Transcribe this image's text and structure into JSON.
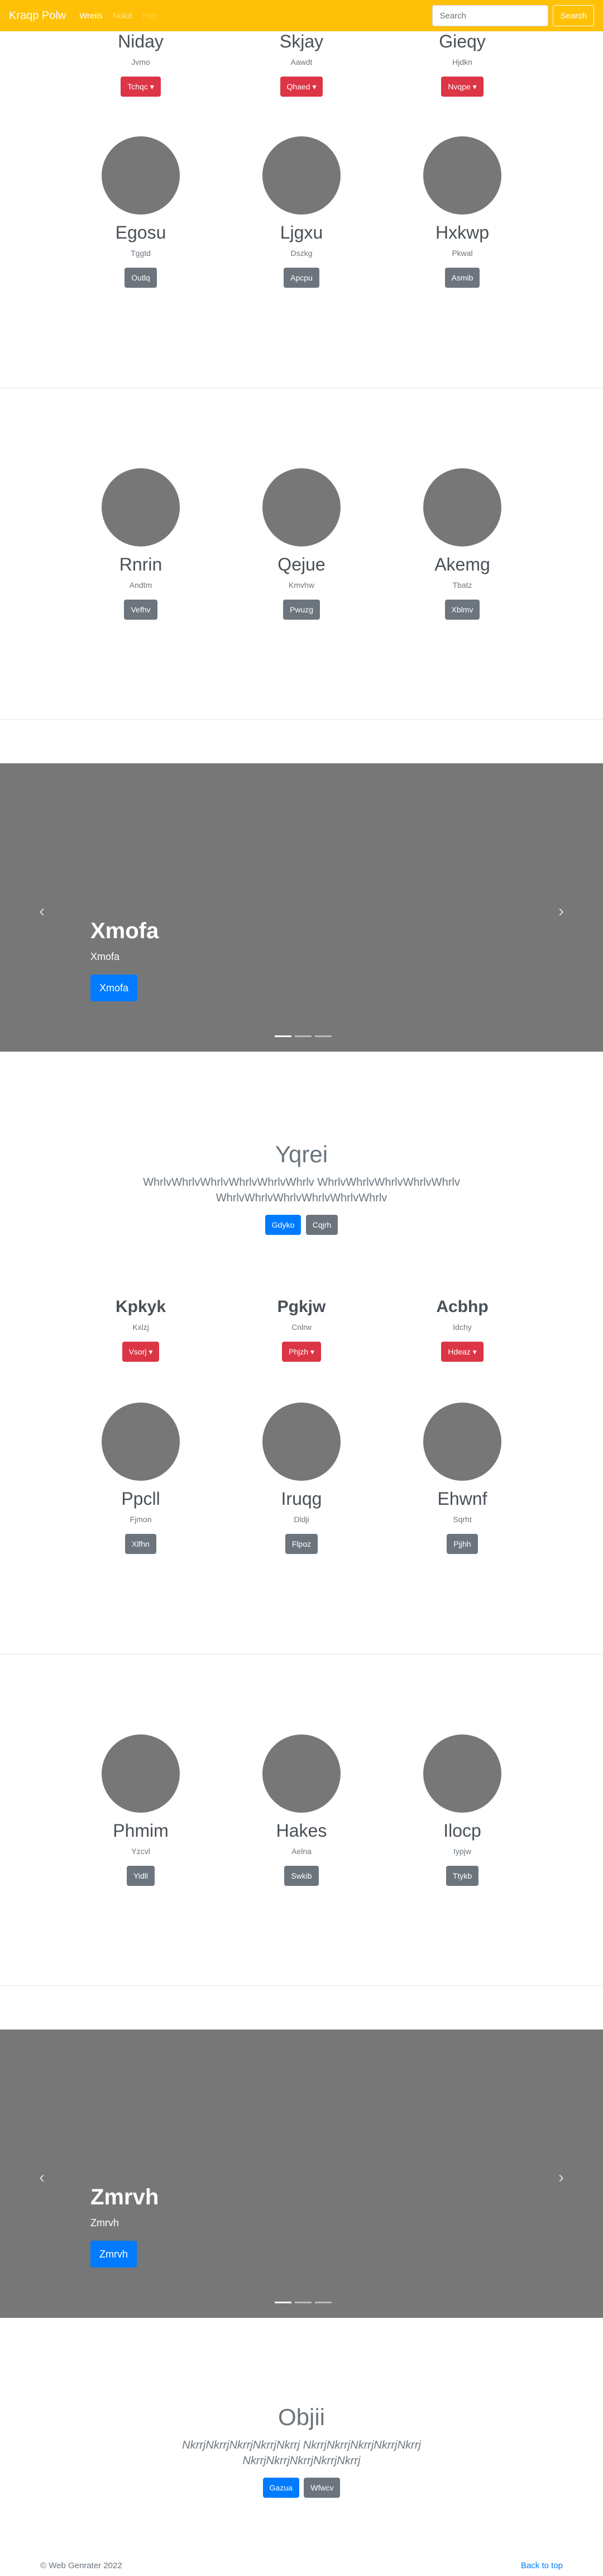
{
  "navbar": {
    "brand": "Kraqp Polw",
    "links": [
      "Wreiis",
      "Nokd",
      "Hxtr"
    ],
    "search_placeholder": "Search",
    "search_button": "Search"
  },
  "row1": [
    {
      "name": "Niday",
      "sub": "Jvmo",
      "button": "Tchqc ▾"
    },
    {
      "name": "Skjay",
      "sub": "Aawdt",
      "button": "Qhaed ▾"
    },
    {
      "name": "Gieqy",
      "sub": "Hjdkn",
      "button": "Nvqpe ▾"
    }
  ],
  "row2": [
    {
      "name": "Egosu",
      "sub": "Tggtd",
      "button": "Outlq"
    },
    {
      "name": "Ljgxu",
      "sub": "Dszkg",
      "button": "Apcpu"
    },
    {
      "name": "Hxkwp",
      "sub": "Pkwal",
      "button": "Asmib"
    }
  ],
  "row3": [
    {
      "name": "Rnrin",
      "sub": "Andtm",
      "button": "Vefhv"
    },
    {
      "name": "Qejue",
      "sub": "Kmvhw",
      "button": "Pwuzg"
    },
    {
      "name": "Akemg",
      "sub": "Tbatz",
      "button": "Xblmv"
    }
  ],
  "carousel1": {
    "title": "Xmofa",
    "text": "Xmofa",
    "button": "Xmofa",
    "prev": "‹",
    "next": "›"
  },
  "jumbo1": {
    "title": "Yqrei",
    "lead": "WhrlvWhrlvWhrlvWhrlvWhrlvWhrlv WhrlvWhrlvWhrlvWhrlvWhrlv WhrlvWhrlvWhrlvWhrlvWhrlvWhrlv",
    "btn1": "Gdyko",
    "btn2": "Cqjrh"
  },
  "row4": [
    {
      "name": "Kpkyk",
      "sub": "Kxlzj",
      "button": "Vsorj ▾"
    },
    {
      "name": "Pgkjw",
      "sub": "Cnlrw",
      "button": "Phjzh ▾"
    },
    {
      "name": "Acbhp",
      "sub": "Idchy",
      "button": "Hdeaz ▾"
    }
  ],
  "row5": [
    {
      "name": "Ppcll",
      "sub": "Fjmon",
      "button": "Xlfhn"
    },
    {
      "name": "Iruqg",
      "sub": "Dldji",
      "button": "Flpoz"
    },
    {
      "name": "Ehwnf",
      "sub": "Sqrht",
      "button": "Pjjhh"
    }
  ],
  "row6": [
    {
      "name": "Phmim",
      "sub": "Yzcvl",
      "button": "Yidll"
    },
    {
      "name": "Hakes",
      "sub": "Aelna",
      "button": "Swkib"
    },
    {
      "name": "Ilocp",
      "sub": "Iypjw",
      "button": "Ttykb"
    }
  ],
  "carousel2": {
    "title": "Zmrvh",
    "text": "Zmrvh",
    "button": "Zmrvh",
    "prev": "‹",
    "next": "›"
  },
  "jumbo2": {
    "title": "Objii",
    "lead": "NkrrjNkrrjNkrrjNkrrjNkrrj NkrrjNkrrjNkrrjNkrrjNkrrj NkrrjNkrrjNkrrjNkrrjNkrrj",
    "btn1": "Gazua",
    "btn2": "Wfwcv"
  },
  "footer": {
    "copyright": "© Web Genrater 2022",
    "back_to_top": "Back to top"
  }
}
